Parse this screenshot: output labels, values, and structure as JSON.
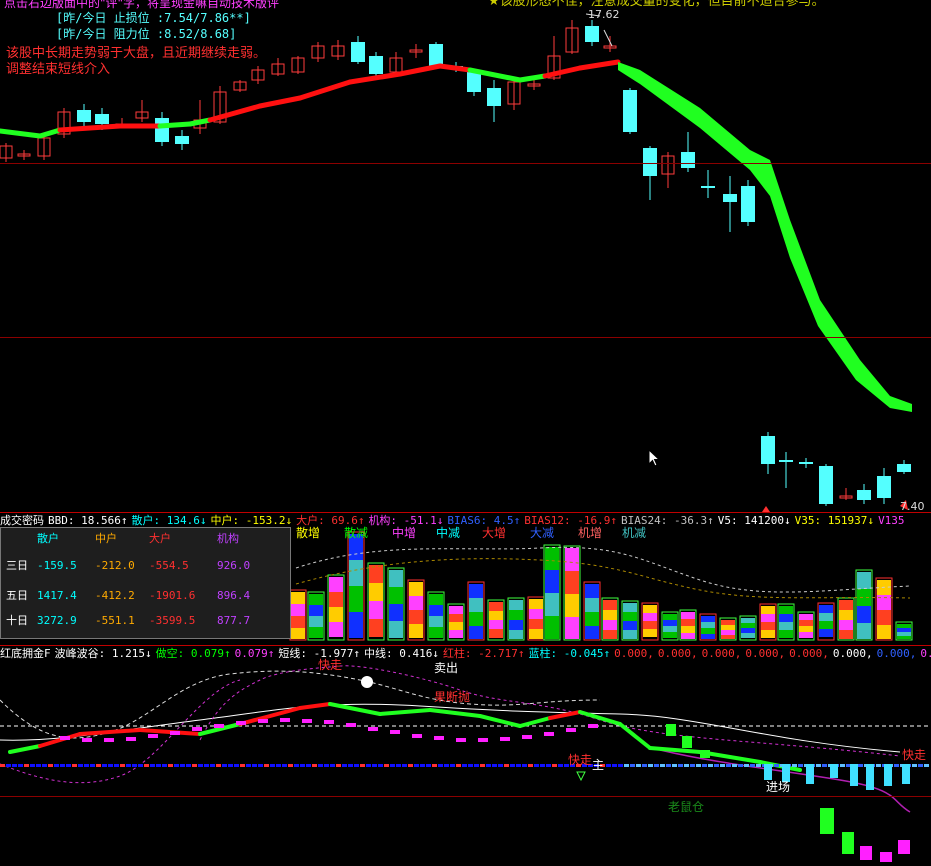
{
  "top_info": {
    "line1": "点击右边版面中的\"评\"字，将呈现金嘛自动技术版评",
    "line2": "[昨/今日 止损位 :7.54/7.86**]",
    "line3": "[昨/今日 阻力位 :8.52/8.68]",
    "line4": "该股中长期走势弱于大盘，且近期继续走弱。",
    "line5": "调整结束短线介入",
    "notice": "★该股形态不佳，注意成交量的变化，但目前不适合参与。",
    "high_label": "17.62",
    "low_label": "7.40"
  },
  "volume_header": {
    "name": "成交密码",
    "items": [
      {
        "text": "BBD: 18.566↑",
        "color": "#ffffff"
      },
      {
        "text": "散户: 134.6↓",
        "color": "#00ffff"
      },
      {
        "text": "中户: -153.2↓",
        "color": "#ffff00"
      },
      {
        "text": "大户: 69.6↑",
        "color": "#ff3030"
      },
      {
        "text": "机构: -51.1↓",
        "color": "#ff40ff"
      },
      {
        "text": "BIAS6: 4.5↑",
        "color": "#3060ff"
      },
      {
        "text": "BIAS12: -16.9↑",
        "color": "#ff3030"
      },
      {
        "text": "BIAS24: -36.3↑",
        "color": "#c0c0c0"
      },
      {
        "text": "V5: 141200↓",
        "color": "#ffffff"
      },
      {
        "text": "V35: 151937↓",
        "color": "#ffff00"
      },
      {
        "text": "V135",
        "color": "#ff40ff"
      }
    ]
  },
  "volume_legend": [
    {
      "text": "散增",
      "color": "#ffff00"
    },
    {
      "text": "散减",
      "color": "#00ff00"
    },
    {
      "text": "中增",
      "color": "#ff40ff"
    },
    {
      "text": "中减",
      "color": "#00ffff"
    },
    {
      "text": "大增",
      "color": "#ff3030"
    },
    {
      "text": "大减",
      "color": "#3060ff"
    },
    {
      "text": "机增",
      "color": "#ff6060"
    },
    {
      "text": "机减",
      "color": "#40c0c0"
    }
  ],
  "fund_table": {
    "headers": [
      "散户",
      "中户",
      "大户",
      "机构"
    ],
    "header_colors": [
      "#00ffff",
      "#ffaa00",
      "#ff3030",
      "#c040ff"
    ],
    "rows": [
      {
        "label": "三日",
        "values": [
          "-159.5",
          "-212.0",
          "-554.5",
          "926.0"
        ]
      },
      {
        "label": "五日",
        "values": [
          "1417.4",
          "-412.2",
          "-1901.6",
          "896.4"
        ]
      },
      {
        "label": "十日",
        "values": [
          "3272.9",
          "-551.1",
          "-3599.5",
          "877.7"
        ]
      }
    ]
  },
  "osc_header": {
    "name": "红底拥金F",
    "items": [
      {
        "text": "波峰波谷: 1.215↓",
        "color": "#ffffff"
      },
      {
        "text": "做空: 0.079↑",
        "color": "#00ff00"
      },
      {
        "text": "0.079↑",
        "color": "#ff40ff"
      },
      {
        "text": "短线: -1.977↑",
        "color": "#ffffff"
      },
      {
        "text": "中线: 0.416↓",
        "color": "#ffffff"
      },
      {
        "text": "红柱: -2.717↑",
        "color": "#ff3030"
      },
      {
        "text": "蓝柱: -0.045↑",
        "color": "#00ffff"
      },
      {
        "text": "0.000,",
        "color": "#ff3030"
      },
      {
        "text": "0.000,",
        "color": "#ff3030"
      },
      {
        "text": "0.000,",
        "color": "#ff3030"
      },
      {
        "text": "0.000,",
        "color": "#ff3030"
      },
      {
        "text": "0.000,",
        "color": "#ff3030"
      },
      {
        "text": "0.000,",
        "color": "#ffffff"
      },
      {
        "text": "0.000,",
        "color": "#3060ff"
      },
      {
        "text": "0.0",
        "color": "#ff40ff"
      }
    ]
  },
  "osc_labels": {
    "kuaizou1": "快走",
    "maichu": "卖出",
    "guoduanpao": "果断抛",
    "kuaizou2": "快走",
    "jinchang": "进场",
    "laoshucang": "老鼠仓",
    "kuaizou3": "快走",
    "zhu": "主"
  },
  "colors": {
    "up": "#ff3c3c",
    "down": "#54ffff",
    "ma_red": "#ff1010",
    "ma_green": "#20ff20",
    "grid": "#8b0000"
  }
}
